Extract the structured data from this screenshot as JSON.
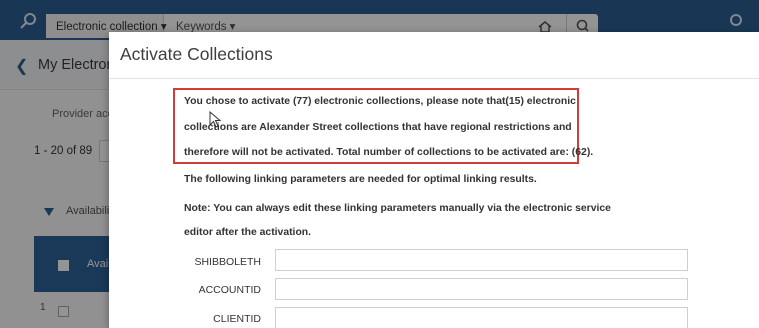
{
  "topbar": {
    "scope_select": "Electronic collection ▾",
    "field_select": "Keywords  ▾",
    "search_scope_icon": "home-icon",
    "search_icon": "search-icon",
    "user_icon": "user-icon"
  },
  "page": {
    "title": "My Electron",
    "provider_tab": "Provider acc",
    "page_count": "1 - 20 of 89",
    "filter_label": "Availabili",
    "table_header_label": "Avai",
    "row_number": "1"
  },
  "dialog": {
    "title": "Activate Collections",
    "message_lines": [
      "You chose to activate (77) electronic collections, please note that(15) electronic",
      "collections are Alexander Street collections that have regional restrictions and",
      "therefore will not be activated. Total number of collections to be activated are: (62)."
    ],
    "info_line": "The following linking parameters are needed for optimal linking results.",
    "note_lines": [
      "Note: You can always edit these linking parameters manually via the electronic service",
      "editor after the activation."
    ],
    "params": [
      {
        "label": "SHIBBOLETH",
        "value": ""
      },
      {
        "label": "ACCOUNTID",
        "value": ""
      },
      {
        "label": "CLIENTID",
        "value": ""
      }
    ]
  },
  "colors": {
    "topbar": "#2c5f93",
    "highlight_border": "#d23b37",
    "table_header": "#2e6299"
  }
}
